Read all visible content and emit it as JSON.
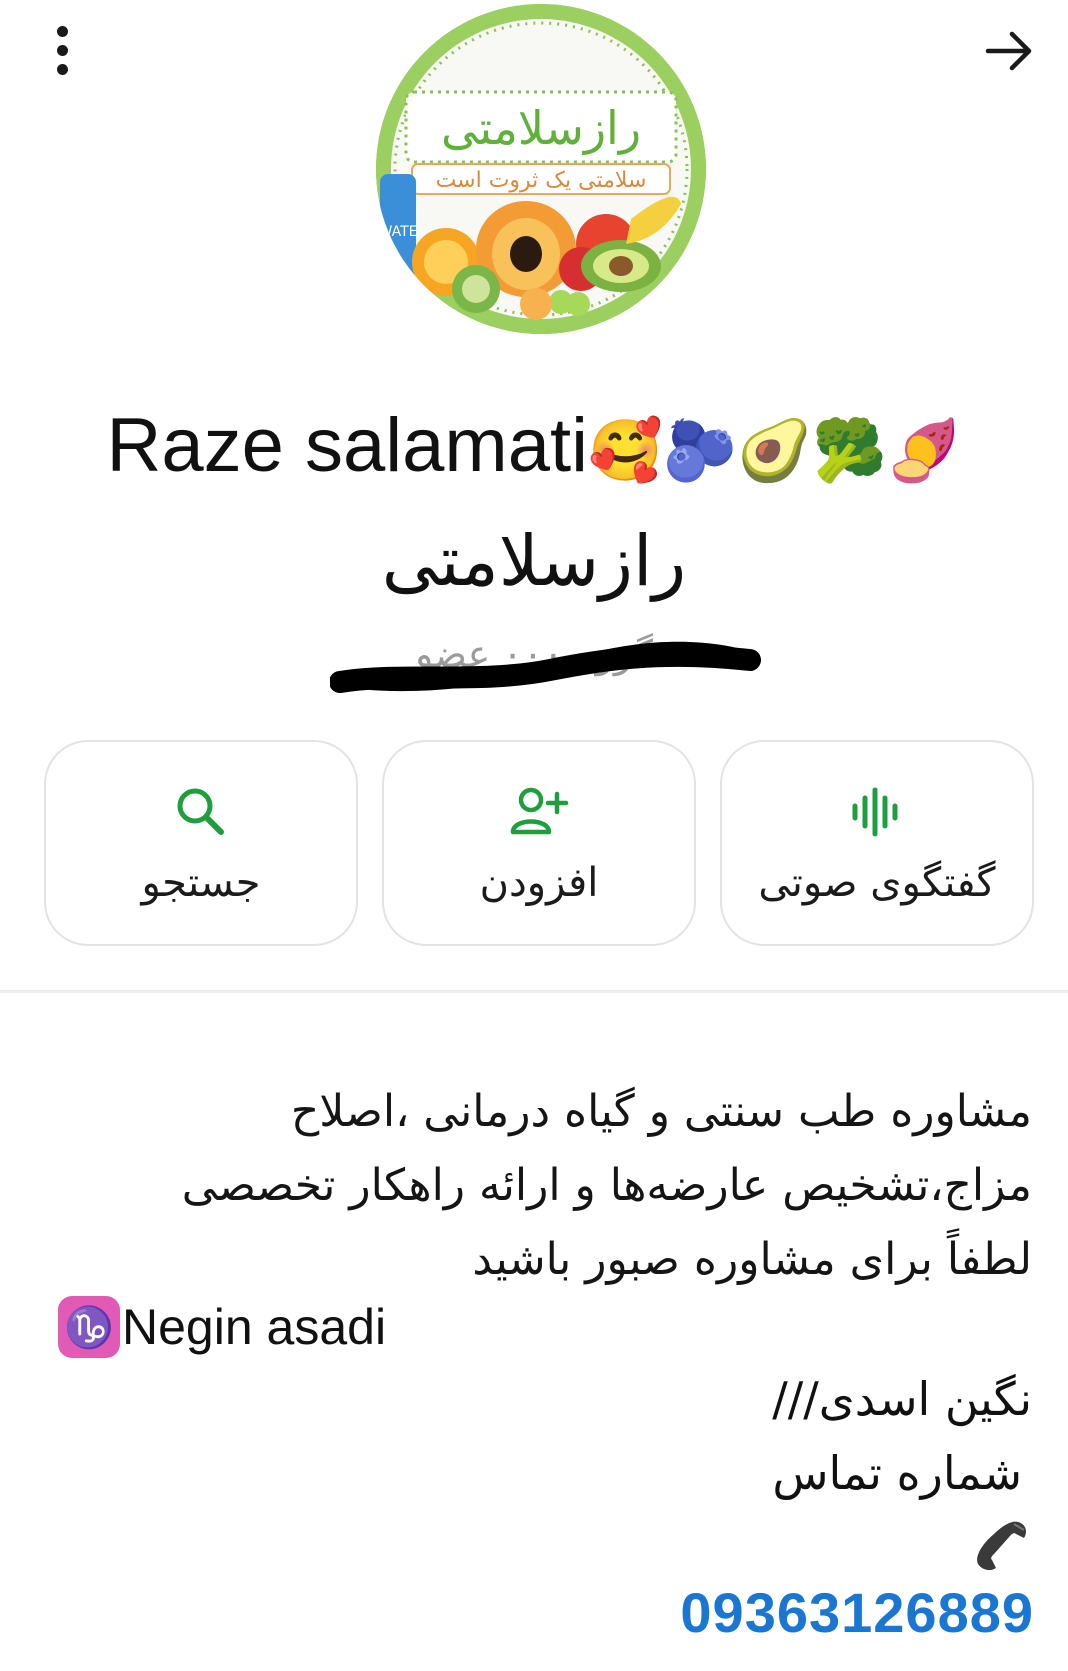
{
  "header": {
    "menu_icon": "more-vert-icon",
    "back_icon": "arrow-right-icon"
  },
  "avatar": {
    "title_text": "رازسلامتی",
    "tagline_text": "سلامتی یک ثروت است",
    "bottle_text": "WATE"
  },
  "profile": {
    "name": "Raze salamati",
    "name_emojis": "🥰🫐🥑🥦🍠",
    "subtitle": "رازسلامتی",
    "members_text": "گروه ۰۰۰ عضو"
  },
  "actions": [
    {
      "label": "گفتگوی صوتی",
      "icon": "voice-chat-icon"
    },
    {
      "label": "افزودن",
      "icon": "add-person-icon"
    },
    {
      "label": "جستجو",
      "icon": "search-icon"
    }
  ],
  "about": {
    "lines": [
      "مشاوره طب سنتی و گیاه درمانی ،اصلاح",
      "مزاج،تشخیص عارضه‌ها و ارائه راهکار تخصصی",
      "لطفاً برای مشاوره صبور باشید"
    ],
    "name_symbol": "♑",
    "name_latin": "Negin asadi",
    "name_fa": "نگین اسدی///",
    "contact_label": "شماره تماس",
    "phone_icon": "telephone-icon",
    "phone": "09363126889"
  },
  "colors": {
    "accent": "#1e9e3c",
    "link": "#1976d2",
    "capricorn_bg": "#e05ab6"
  }
}
